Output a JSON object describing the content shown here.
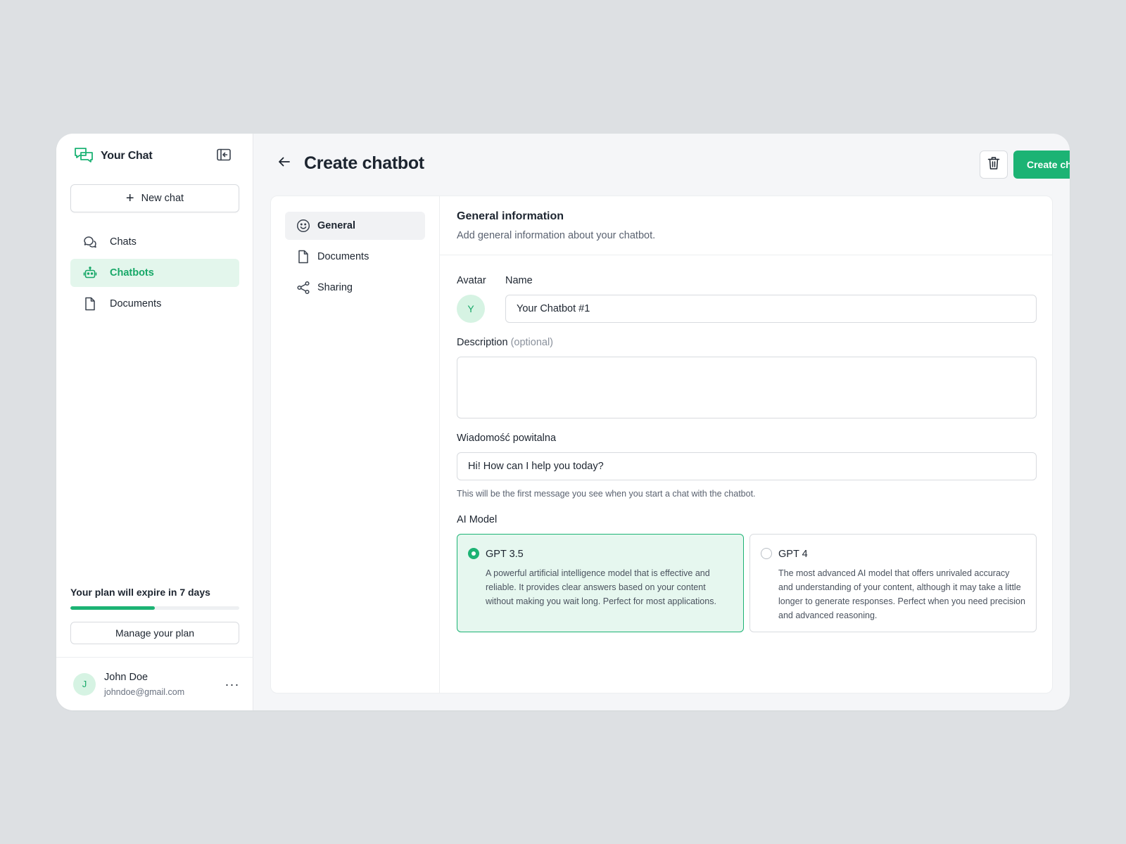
{
  "brand": {
    "name": "Your Chat"
  },
  "sidebar": {
    "new_chat_label": "New chat",
    "items": [
      {
        "label": "Chats",
        "icon": "chats-icon",
        "active": false
      },
      {
        "label": "Chatbots",
        "icon": "robot-icon",
        "active": true
      },
      {
        "label": "Documents",
        "icon": "document-icon",
        "active": false
      }
    ],
    "plan": {
      "text": "Your plan will expire in 7 days",
      "progress_fraction": 0.5,
      "manage_label": "Manage your plan"
    },
    "user": {
      "initial": "J",
      "name": "John Doe",
      "email": "johndoe@gmail.com",
      "more": "···"
    }
  },
  "header": {
    "title": "Create chatbot",
    "create_label": "Create chatbot"
  },
  "subnav": {
    "items": [
      {
        "label": "General",
        "icon": "smiley-icon",
        "active": true
      },
      {
        "label": "Documents",
        "icon": "document-icon",
        "active": false
      },
      {
        "label": "Sharing",
        "icon": "share-icon",
        "active": false
      }
    ]
  },
  "form": {
    "section_title": "General information",
    "section_subtitle": "Add general information about your chatbot.",
    "avatar_label": "Avatar",
    "avatar_initial": "Y",
    "name_label": "Name",
    "name_value": "Your Chatbot #1",
    "description_label": "Description",
    "description_optional": "(optional)",
    "description_value": "",
    "welcome_label": "Wiadomość powitalna",
    "welcome_value": "Hi! How can I help you today?",
    "welcome_hint": "This will be the first message you see when you start a chat with the chatbot.",
    "model_label": "AI Model",
    "models": [
      {
        "name": "GPT 3.5",
        "selected": true,
        "description": "A powerful artificial intelligence model that is effective and reliable. It provides clear answers based on your content without making you wait long. Perfect for most applications."
      },
      {
        "name": "GPT 4",
        "selected": false,
        "description": "The most advanced AI model that offers unrivaled accuracy and understanding of your content, although it may take a little longer to generate responses. Perfect when you need precision and advanced reasoning."
      }
    ]
  },
  "colors": {
    "accent": "#1cb374",
    "accent_light": "#e3f6ec",
    "background": "#dde0e3"
  }
}
